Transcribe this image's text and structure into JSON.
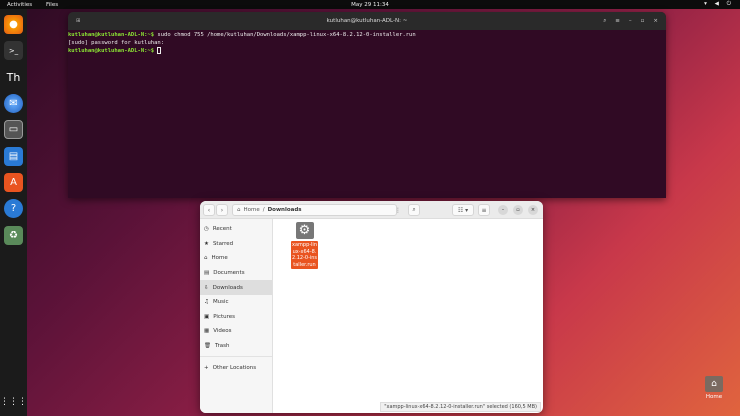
{
  "topbar": {
    "activities": "Activities",
    "app": "Files",
    "clock": "May 29  11:34",
    "tray": "▾ ◀ ⏻"
  },
  "dock": {
    "apps": [
      "firefox",
      "terminal",
      "typora",
      "thunderbird",
      "files",
      "writer",
      "software",
      "help",
      "trash"
    ],
    "grid": "⋮⋮⋮"
  },
  "terminal": {
    "title": "kutluhan@kutluhan-ADL-N: ~",
    "lines": [
      {
        "prompt": "kutluhan@kutluhan-ADL-N:~$",
        "cmd": " sudo chmod 755 /home/kutluhan/Downloads/xampp-linux-x64-8.2.12-0-installer.run"
      },
      {
        "text": "[sudo] password for kutluhan:"
      },
      {
        "prompt": "kutluhan@kutluhan-ADL-N:~$",
        "cmd": " "
      }
    ]
  },
  "files": {
    "breadcrumb": {
      "home": "Home",
      "current": "Downloads"
    },
    "sidebar": [
      {
        "label": "Recent",
        "icon": "◷"
      },
      {
        "label": "Starred",
        "icon": "★"
      },
      {
        "label": "Home",
        "icon": "⌂"
      },
      {
        "label": "Documents",
        "icon": "▤"
      },
      {
        "label": "Downloads",
        "icon": "⇩"
      },
      {
        "label": "Music",
        "icon": "♫"
      },
      {
        "label": "Pictures",
        "icon": "▣"
      },
      {
        "label": "Videos",
        "icon": "▦"
      },
      {
        "label": "Trash",
        "icon": "🗑"
      }
    ],
    "other_locations": "Other Locations",
    "file_name": "xampp-linux-x64-8.2.12-0-installer.run",
    "status": "\"xampp-linux-x64-8.2.12-0-installer.run\" selected  (160,5 MB)"
  },
  "desktop": {
    "home_label": "Home"
  }
}
